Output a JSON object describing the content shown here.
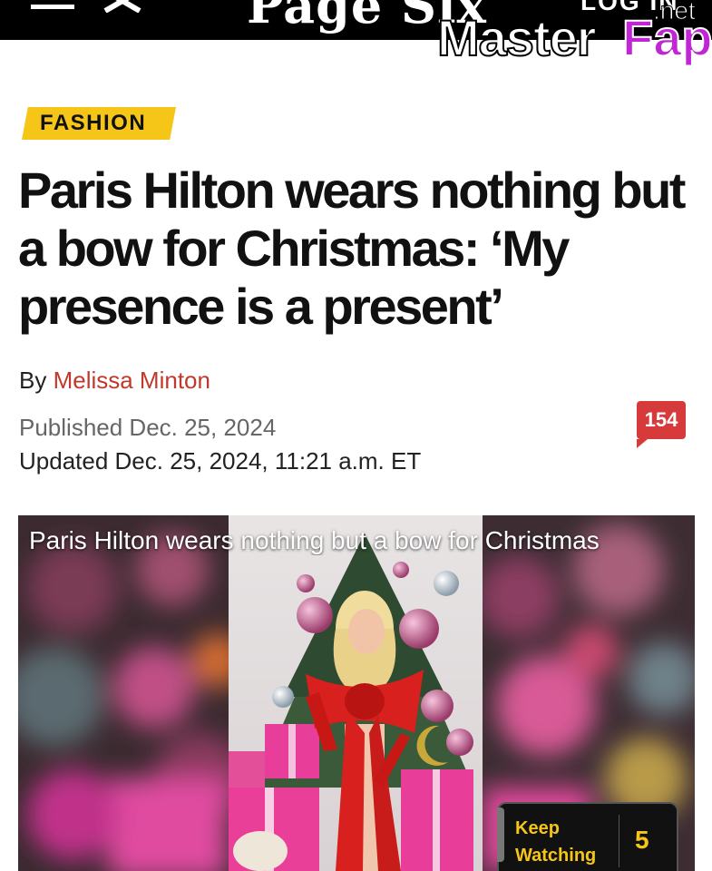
{
  "header": {
    "site_name": "Page Six",
    "login_label": "LOG IN",
    "menu_icon": "hamburger-menu-icon",
    "close_icon": "close-x-icon"
  },
  "watermark": {
    "part1": "Master",
    "part2": "Fap",
    "part3": ".net"
  },
  "article": {
    "category": "FASHION",
    "headline": "Paris Hilton wears nothing but a bow for Christmas: ‘My presence is a present’",
    "byline_prefix": "By",
    "author": "Melissa Minton",
    "published": "Published Dec. 25, 2024",
    "updated": "Updated Dec. 25, 2024, 11:21 a.m. ET",
    "comment_count": "154"
  },
  "video": {
    "title": "Paris Hilton wears nothing but a bow for Christmas"
  },
  "keep_watching": {
    "label": "Keep Watching",
    "count": "5"
  },
  "colors": {
    "tag_yellow": "#f5c518",
    "author_red": "#c0392b",
    "badge_red": "#d63a3a",
    "topbar": "#000000"
  }
}
